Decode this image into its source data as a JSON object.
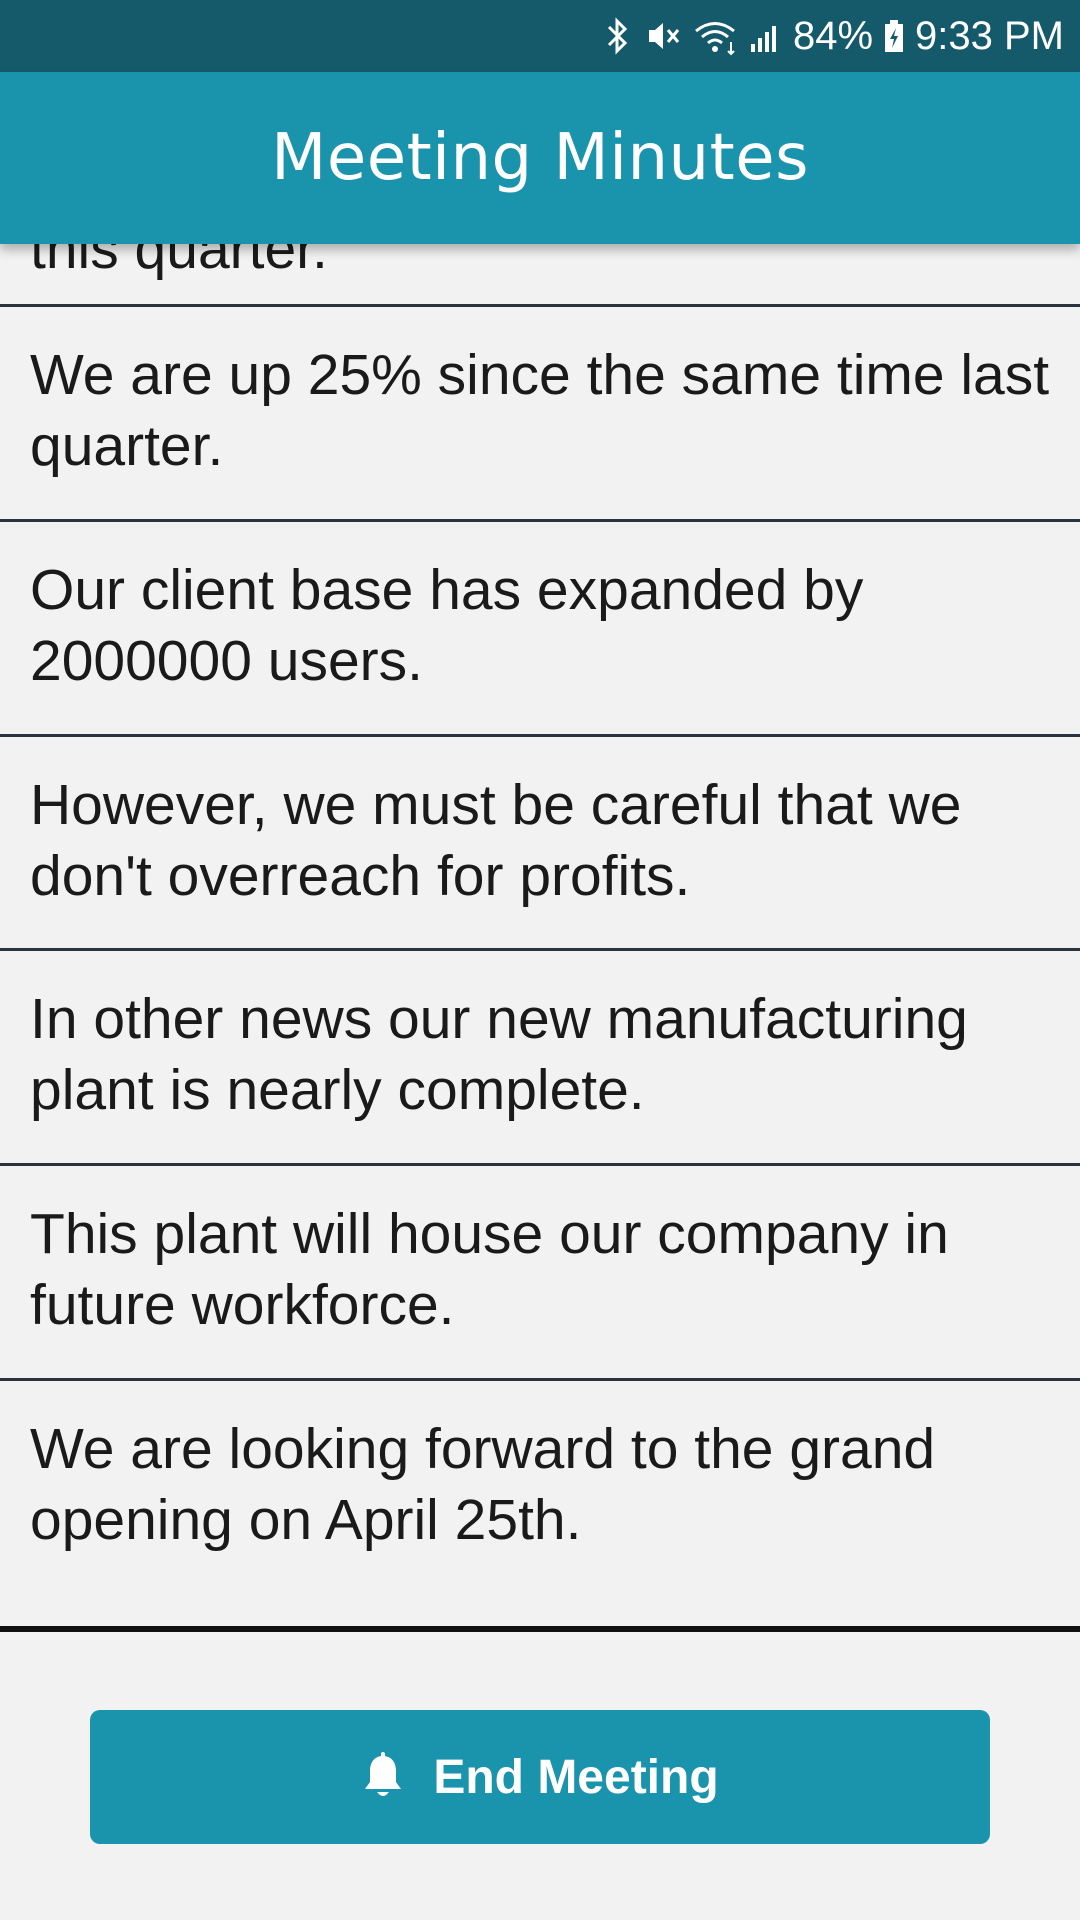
{
  "status_bar": {
    "battery": "84%",
    "time": "9:33 PM",
    "icons": [
      "bluetooth-icon",
      "vibrate-icon",
      "wifi-icon",
      "signal-icon",
      "battery-charging-icon"
    ]
  },
  "app_bar": {
    "title": "Meeting Minutes"
  },
  "minutes": [
    "this quarter.",
    "We are up 25% since the same time last quarter.",
    "Our client base has expanded by 2000000 users.",
    "However, we must be careful that we don't overreach for profits.",
    "In other news our new manufacturing plant is nearly complete.",
    "This plant will house our company in future workforce.",
    "We are looking forward to the grand opening on April 25th."
  ],
  "end_button": {
    "label": "End Meeting",
    "icon": "bell-icon"
  },
  "colors": {
    "status_bar": "#155a6b",
    "accent": "#1a93ad",
    "background": "#f2f2f2",
    "text": "#1a1a1a"
  }
}
